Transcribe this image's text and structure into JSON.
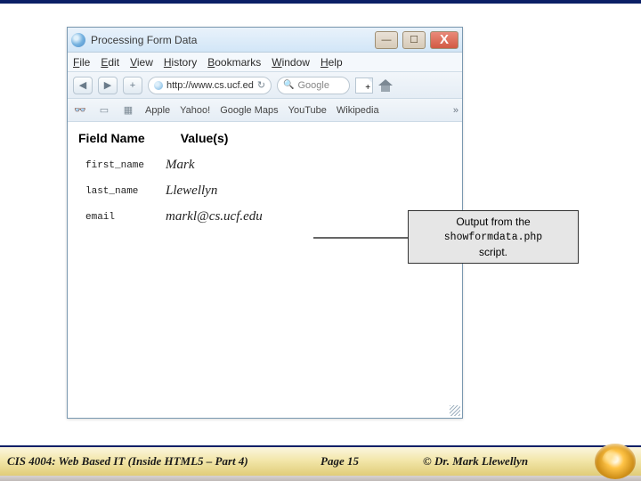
{
  "window": {
    "title": "Processing Form Data"
  },
  "menu": {
    "items": [
      "File",
      "Edit",
      "View",
      "History",
      "Bookmarks",
      "Window",
      "Help"
    ]
  },
  "nav": {
    "url": "http://www.cs.ucf.ed",
    "search_placeholder": "Google"
  },
  "bookmarks": {
    "items": [
      "Apple",
      "Yahoo!",
      "Google Maps",
      "YouTube",
      "Wikipedia"
    ]
  },
  "output": {
    "header_field": "Field Name",
    "header_value": "Value(s)",
    "rows": [
      {
        "field": "first_name",
        "value": "Mark"
      },
      {
        "field": "last_name",
        "value": "Llewellyn"
      },
      {
        "field": "email",
        "value": "markl@cs.ucf.edu"
      }
    ]
  },
  "callout": {
    "line1": "Output from the",
    "script": "showformdata.php",
    "line3": "script."
  },
  "footer": {
    "course": "CIS 4004: Web Based IT (Inside HTML5 – Part 4)",
    "page": "Page 15",
    "author": "© Dr. Mark Llewellyn"
  }
}
